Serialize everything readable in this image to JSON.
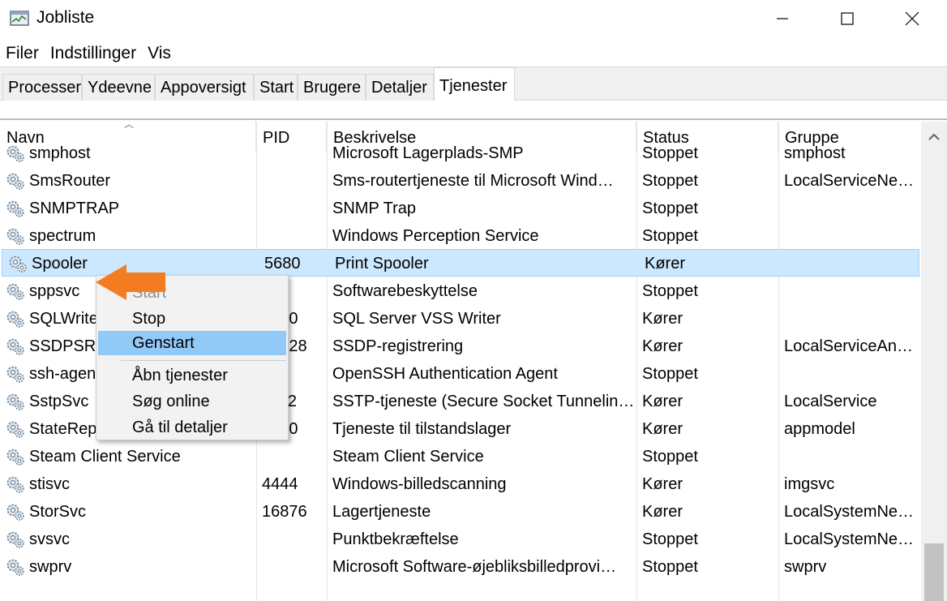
{
  "window": {
    "title": "Jobliste"
  },
  "menu": [
    "Filer",
    "Indstillinger",
    "Vis"
  ],
  "tabs": [
    {
      "label": "Processer",
      "active": false
    },
    {
      "label": "Ydeevne",
      "active": false
    },
    {
      "label": "Appoversigt",
      "active": false
    },
    {
      "label": "Start",
      "active": false
    },
    {
      "label": "Brugere",
      "active": false
    },
    {
      "label": "Detaljer",
      "active": false
    },
    {
      "label": "Tjenester",
      "active": true
    }
  ],
  "columns": [
    "Navn",
    "PID",
    "Beskrivelse",
    "Status",
    "Gruppe"
  ],
  "rows": [
    {
      "name": "smphost",
      "pid": "",
      "desc": "Microsoft Lagerplads-SMP",
      "status": "Stoppet",
      "group": "smphost"
    },
    {
      "name": "SmsRouter",
      "pid": "",
      "desc": "Sms-routertjeneste til Microsoft Wind…",
      "status": "Stoppet",
      "group": "LocalServiceNe…"
    },
    {
      "name": "SNMPTRAP",
      "pid": "",
      "desc": "SNMP Trap",
      "status": "Stoppet",
      "group": ""
    },
    {
      "name": "spectrum",
      "pid": "",
      "desc": "Windows Perception Service",
      "status": "Stoppet",
      "group": ""
    },
    {
      "name": "Spooler",
      "pid": "5680",
      "desc": "Print Spooler",
      "status": "Kører",
      "group": "",
      "selected": true
    },
    {
      "name": "sppsvc",
      "pid": "",
      "desc": "Softwarebeskyttelse",
      "status": "Stoppet",
      "group": ""
    },
    {
      "name": "SQLWriter",
      "pid": "5040",
      "desc": "SQL Server VSS Writer",
      "status": "Kører",
      "group": ""
    },
    {
      "name": "SSDPSRV",
      "pid": "12128",
      "desc": "SSDP-registrering",
      "status": "Kører",
      "group": "LocalServiceAn…"
    },
    {
      "name": "ssh-agent",
      "pid": "",
      "desc": "OpenSSH Authentication Agent",
      "status": "Stoppet",
      "group": ""
    },
    {
      "name": "SstpSvc",
      "pid": "4112",
      "desc": "SSTP-tjeneste (Secure Socket Tunnelin…",
      "status": "Kører",
      "group": "LocalService"
    },
    {
      "name": "StateRepository",
      "pid": "2320",
      "desc": "Tjeneste til tilstandslager",
      "status": "Kører",
      "group": "appmodel"
    },
    {
      "name": "Steam Client Service",
      "pid": "",
      "desc": "Steam Client Service",
      "status": "Stoppet",
      "group": ""
    },
    {
      "name": "stisvc",
      "pid": "4444",
      "desc": "Windows-billedscanning",
      "status": "Kører",
      "group": "imgsvc"
    },
    {
      "name": "StorSvc",
      "pid": "16876",
      "desc": "Lagertjeneste",
      "status": "Kører",
      "group": "LocalSystemNe…"
    },
    {
      "name": "svsvc",
      "pid": "",
      "desc": "Punktbekræftelse",
      "status": "Stoppet",
      "group": "LocalSystemNe…"
    },
    {
      "name": "swprv",
      "pid": "",
      "desc": "Microsoft Software-øjebliksbilledprovi…",
      "status": "Stoppet",
      "group": "swprv"
    }
  ],
  "context_menu": {
    "start": "Start",
    "stop": "Stop",
    "restart": "Genstart",
    "open_services": "Åbn tjenester",
    "search_online": "Søg online",
    "go_to_details": "Gå til detaljer"
  },
  "colors": {
    "selection": "#cce8ff",
    "menu_hover": "#91c9f7",
    "arrow": "#f47c20"
  }
}
